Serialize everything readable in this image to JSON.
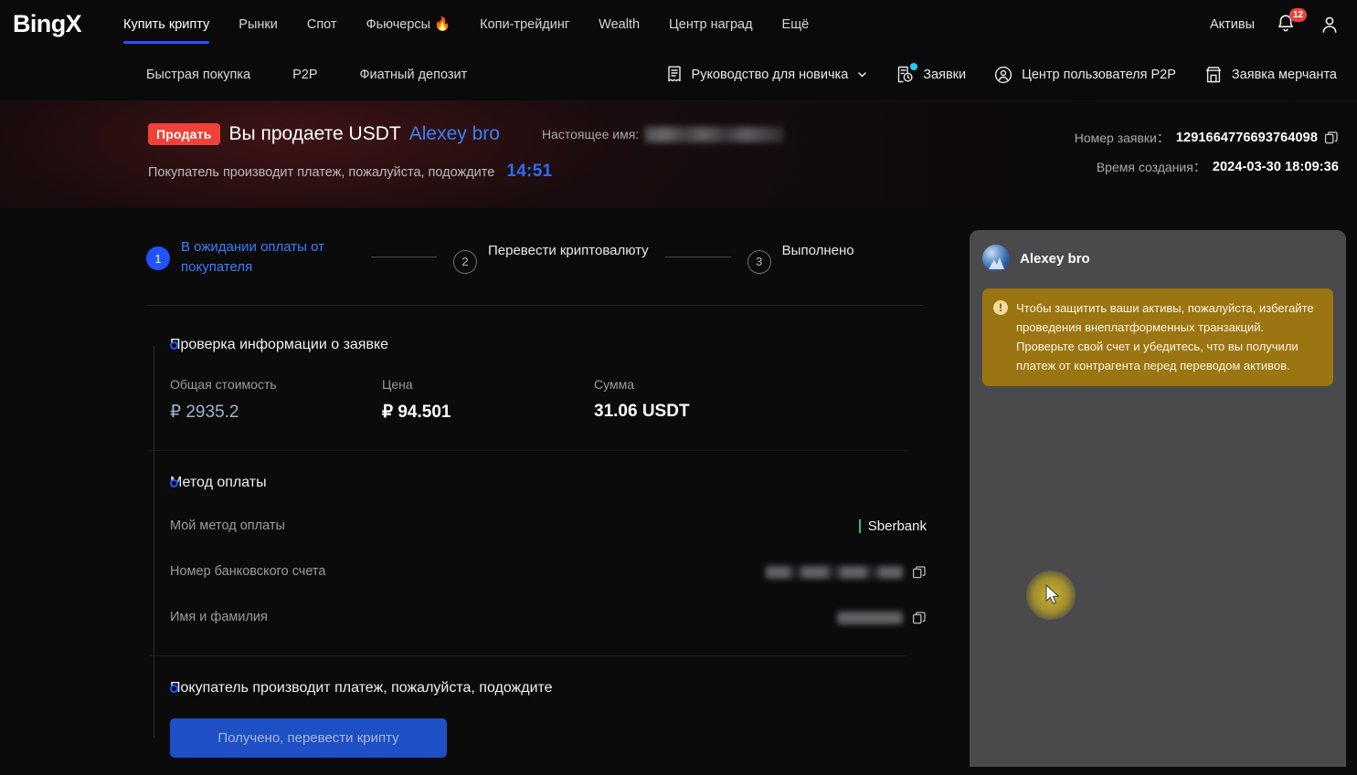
{
  "topnav": {
    "logo": "BingX",
    "items": [
      {
        "label": "Купить крипту",
        "active": true
      },
      {
        "label": "Рынки",
        "active": false
      },
      {
        "label": "Спот",
        "active": false
      },
      {
        "label": "Фьючерсы 🔥",
        "active": false
      },
      {
        "label": "Копи-трейдинг",
        "active": false
      },
      {
        "label": "Wealth",
        "active": false
      },
      {
        "label": "Центр наград",
        "active": false
      },
      {
        "label": "Ещё",
        "active": false
      }
    ],
    "assets_label": "Активы",
    "notification_count": "12"
  },
  "subnav": {
    "left": [
      "Быстрая покупка",
      "P2P",
      "Фиатный депозит"
    ],
    "right": [
      {
        "label": "Руководство для новичка",
        "icon": "guide-icon",
        "caret": true
      },
      {
        "label": "Заявки",
        "icon": "orders-icon",
        "dot": true
      },
      {
        "label": "Центр пользователя P2P",
        "icon": "user-circle-icon"
      },
      {
        "label": "Заявка мерчанта",
        "icon": "store-icon"
      }
    ]
  },
  "banner": {
    "pill": "Продать",
    "title": "Вы продаете USDT",
    "counterparty": "Alexey bro",
    "realname_label": "Настоящее имя:",
    "wait_text": "Покупатель производит платеж, пожалуйста, подождите",
    "timer": "14:51",
    "order_no_label": "Номер заявки：",
    "order_no": "1291664776693764098",
    "created_label": "Время создания：",
    "created": "2024-03-30 18:09:36"
  },
  "stepper": [
    {
      "num": "1",
      "label": "В ожидании оплаты от покупателя",
      "active": true
    },
    {
      "num": "2",
      "label": "Перевести криптовалюту",
      "active": false
    },
    {
      "num": "3",
      "label": "Выполнено",
      "active": false
    }
  ],
  "order_info": {
    "title": "Проверка информации о заявке",
    "cells": [
      {
        "label": "Общая стоимость",
        "value": "₽ 2935.2",
        "muted": true
      },
      {
        "label": "Цена",
        "value": "₽ 94.501",
        "muted": false
      },
      {
        "label": "Сумма",
        "value": "31.06 USDT",
        "muted": false
      }
    ]
  },
  "payment": {
    "title": "Метод оплаты",
    "rows": [
      {
        "label": "Мой метод оплаты",
        "value": "Sberbank",
        "type": "bank"
      },
      {
        "label": "Номер банковского счета",
        "value": "",
        "type": "masked-long",
        "copy": true
      },
      {
        "label": "Имя и фамилия",
        "value": "",
        "type": "masked-short",
        "copy": true
      }
    ]
  },
  "final": {
    "title": "Покупатель производит платеж, пожалуйста, подождите",
    "cta": "Получено, перевести крипту"
  },
  "chat": {
    "name": "Alexey bro",
    "warning": "Чтобы защитить ваши активы, пожалуйста, избегайте проведения внеплатформенных транзакций. Проверьте свой счет и убедитесь, что вы получили платеж от контрагента перед переводом активов.",
    "warning_icon": "!"
  },
  "colors": {
    "accent_blue": "#2152ff",
    "link_blue": "#3d7dfb",
    "sell_red": "#ef4136",
    "warning_gold": "#9a7512",
    "bank_green": "#2bbf7e",
    "badge_red": "#e8463c",
    "dot_cyan": "#1fd0f0"
  }
}
